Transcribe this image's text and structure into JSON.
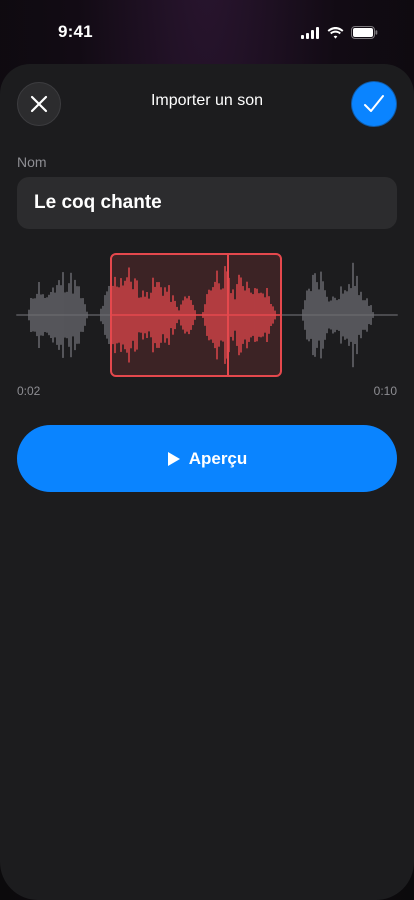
{
  "status_bar": {
    "time": "9:41"
  },
  "sheet": {
    "title": "Importer un son",
    "name_label": "Nom",
    "name_value": "Le coq chante"
  },
  "trim": {
    "start_time": "0:02",
    "end_time": "0:10"
  },
  "preview_button": {
    "label": "Aperçu"
  },
  "icons": {
    "close": "close-icon",
    "confirm": "checkmark-icon",
    "play": "play-icon",
    "signal": "cellular-signal-icon",
    "wifi": "wifi-icon",
    "battery": "battery-icon"
  },
  "colors": {
    "accent": "#0a84ff",
    "selection": "#e5484d",
    "waveform": "#6e6e73",
    "sheet": "#1c1c1e"
  }
}
